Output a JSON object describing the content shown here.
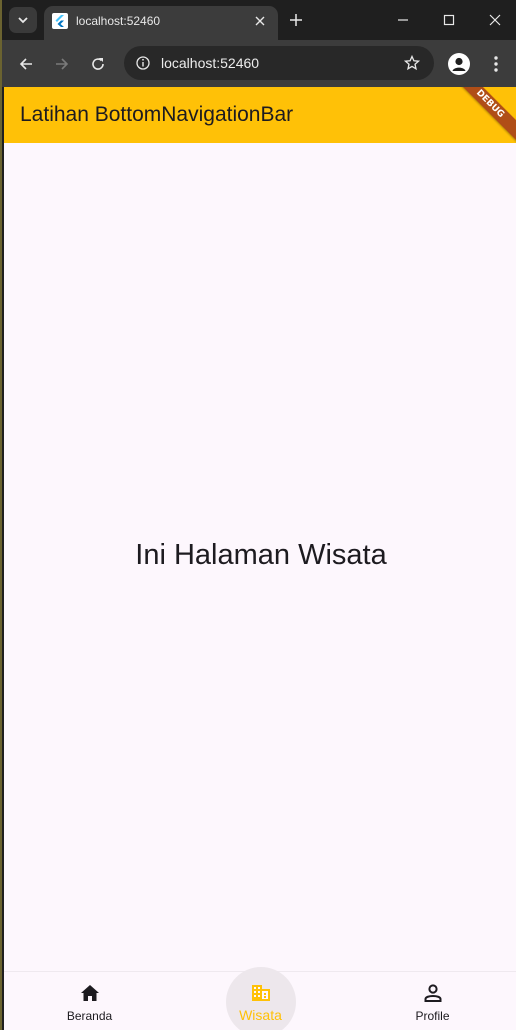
{
  "browser": {
    "tab_title": "localhost:52460",
    "url": "localhost:52460"
  },
  "app": {
    "appbar_title": "Latihan BottomNavigationBar",
    "debug_banner": "DEBUG",
    "body_text": "Ini Halaman Wisata",
    "colors": {
      "primary": "#ffc107",
      "debug": "#b04e17",
      "background": "#fdf7fd"
    }
  },
  "bottom_nav": {
    "items": [
      {
        "label": "Beranda",
        "icon": "home-icon",
        "active": false
      },
      {
        "label": "Wisata",
        "icon": "building-icon",
        "active": true
      },
      {
        "label": "Profile",
        "icon": "person-icon",
        "active": false
      }
    ]
  }
}
